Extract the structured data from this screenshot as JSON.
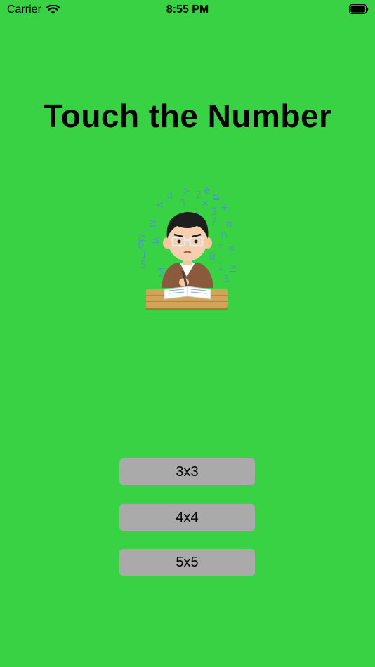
{
  "status_bar": {
    "carrier": "Carrier",
    "time": "8:55 PM",
    "icons": [
      "wifi-icon",
      "battery-icon"
    ]
  },
  "main": {
    "title": "Touch the Number",
    "illustration_icon": "studying-student-icon",
    "buttons": [
      {
        "label": "3x3"
      },
      {
        "label": "4x4"
      },
      {
        "label": "5x5"
      }
    ]
  },
  "colors": {
    "background": "#3ad245",
    "button": "#aaaaaa",
    "text": "#000000"
  }
}
